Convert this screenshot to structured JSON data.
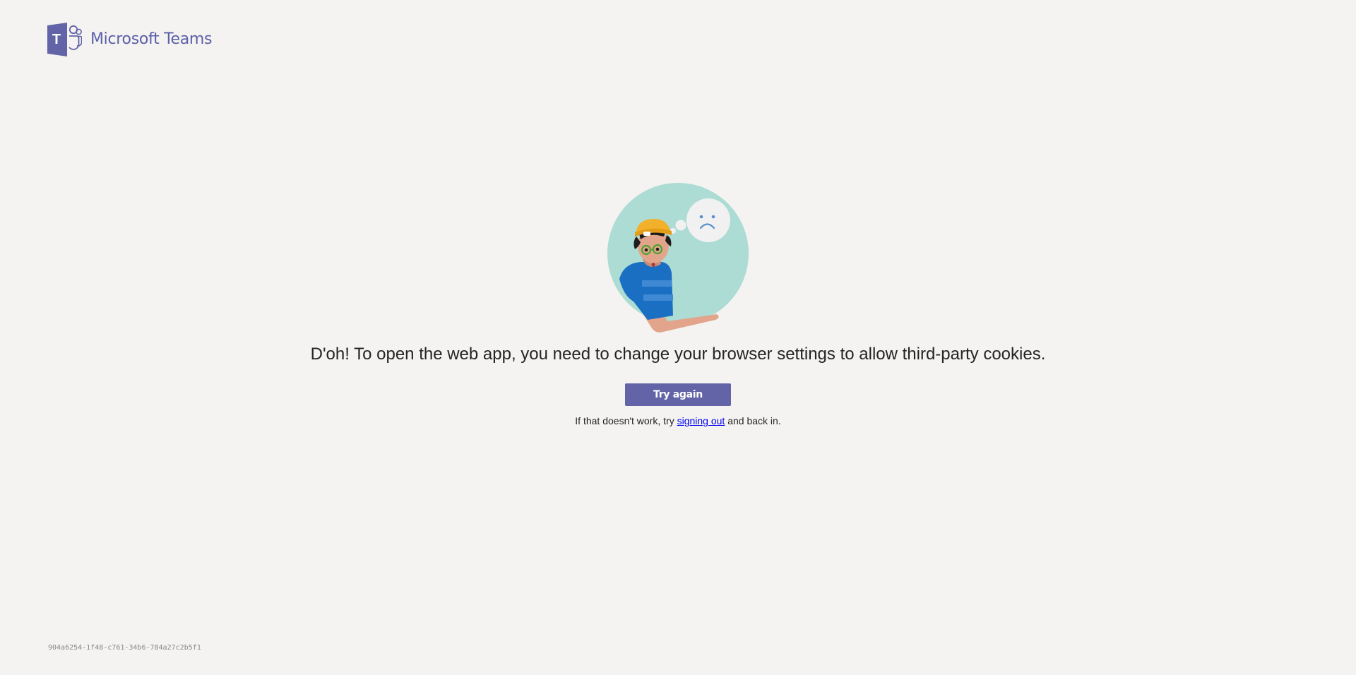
{
  "brand": {
    "name": "Microsoft Teams",
    "logo_letter": "T",
    "color": "#6264a7"
  },
  "error": {
    "illustration_icon": "sad-person-thought-bubble-illustration",
    "message": "D'oh! To open the web app, you need to change your browser settings to allow third-party cookies."
  },
  "actions": {
    "try_again_label": "Try again",
    "hint_prefix": "If that doesn't work, try ",
    "signout_link_label": "signing out",
    "hint_suffix": " and back in."
  },
  "footer": {
    "session_id": "904a6254-1f48-c761-34b6-784a27c2b5f1"
  }
}
